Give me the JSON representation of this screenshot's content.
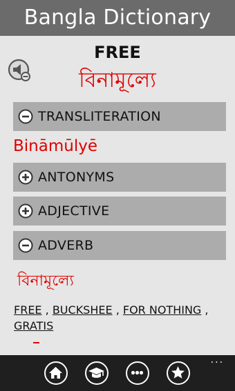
{
  "app": {
    "title": "Bangla Dictionary"
  },
  "entry": {
    "word": "FREE",
    "bengali": "বিনামূল্যে"
  },
  "sections": {
    "transliteration": {
      "label": "TRANSLITERATION",
      "state": "expanded",
      "value": "Bināmūlyē"
    },
    "antonyms": {
      "label": "ANTONYMS",
      "state": "collapsed"
    },
    "adjective": {
      "label": "ADJECTIVE",
      "state": "collapsed"
    },
    "adverb": {
      "label": "ADVERB",
      "state": "expanded",
      "bengali": "বিনামূল্যে",
      "synonyms": [
        "FREE",
        "BUCKSHEE",
        "FOR NOTHING",
        "GRATIS"
      ],
      "separator": ","
    }
  },
  "appbar": {
    "buttons": [
      "home-icon",
      "graduation-cap-icon",
      "more-horizontal-icon",
      "star-icon"
    ],
    "more": "..."
  },
  "colors": {
    "accent": "#e00000",
    "title_bar": "#6b6b6b",
    "section_bar": "#acacac",
    "app_bar": "#1f1f1f"
  }
}
